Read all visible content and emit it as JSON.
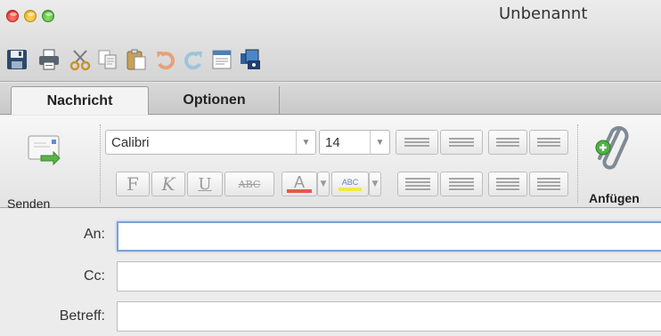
{
  "window": {
    "title": "Unbenannt"
  },
  "quick_toolbar": {
    "icons": [
      "save-icon",
      "print-icon",
      "cut-icon",
      "copy-icon",
      "paste-icon",
      "undo-icon",
      "redo-icon",
      "toolbox-icon",
      "media-browser-icon"
    ]
  },
  "tabs": [
    {
      "label": "Nachricht",
      "active": true
    },
    {
      "label": "Optionen",
      "active": false
    }
  ],
  "ribbon": {
    "send_label": "Senden",
    "font_name": "Calibri",
    "font_size": "14",
    "bold_label": "F",
    "italic_label": "K",
    "underline_label": "U",
    "strike_label": "ABC",
    "font_color_label": "A",
    "highlight_label": "ABC",
    "attach_label": "Anfügen",
    "font_color": "#e05a4f",
    "highlight_color": "#f3e84a"
  },
  "form": {
    "to_label": "An:",
    "cc_label": "Cc:",
    "subject_label": "Betreff:",
    "to_value": "",
    "cc_value": "",
    "subject_value": ""
  }
}
